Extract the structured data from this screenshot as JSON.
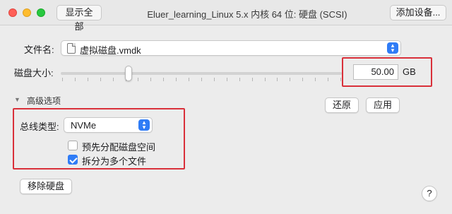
{
  "window": {
    "title": "Eluer_learning_Linux 5.x 内核 64 位: 硬盘 (SCSI)",
    "show_all_label": "显示全部",
    "add_device_label": "添加设备..."
  },
  "file": {
    "label": "文件名:",
    "value": "虚拟磁盘.vmdk"
  },
  "disk_size": {
    "label": "磁盘大小:",
    "value": "50.00",
    "unit": "GB",
    "slider_fraction": 0.24
  },
  "advanced": {
    "label": "高级选项",
    "bus_type_label": "总线类型:",
    "bus_type_value": "NVMe",
    "preallocate_label": "预先分配磁盘空间",
    "preallocate_checked": false,
    "split_label": "拆分为多个文件",
    "split_checked": true
  },
  "buttons": {
    "revert": "还原",
    "apply": "应用",
    "remove_disk": "移除硬盘",
    "help": "?"
  },
  "colors": {
    "highlight_box": "#d9303a",
    "accent": "#2f7cf6"
  }
}
